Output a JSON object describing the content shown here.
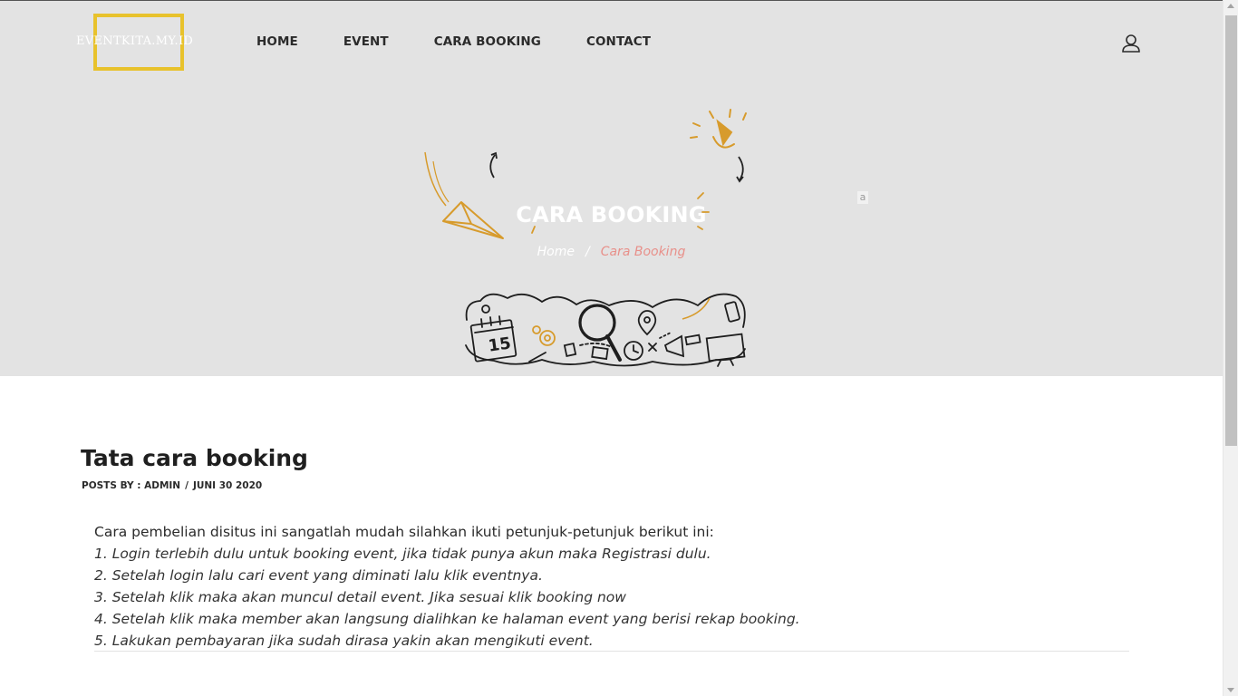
{
  "header": {
    "logo_text": "EVENTKITA.MY.ID",
    "nav": [
      {
        "label": "HOME"
      },
      {
        "label": "EVENT"
      },
      {
        "label": "CARA BOOKING"
      },
      {
        "label": "CONTACT"
      }
    ],
    "user_icon": "user-icon"
  },
  "hero": {
    "title": "CARA BOOKING",
    "breadcrumb": {
      "home": "Home",
      "separator": "/",
      "current": "Cara Booking"
    },
    "stray_text": "a",
    "calendar_number": "15"
  },
  "post": {
    "title": "Tata cara booking",
    "meta_author": "POSTS BY : ADMIN",
    "meta_sep": "/",
    "meta_date": "JUNI 30 2020",
    "intro": "Cara pembelian disitus ini sangatlah mudah silahkan ikuti petunjuk-petunjuk berikut ini:",
    "steps": [
      "1. Login terlebih dulu untuk booking event, jika tidak punya akun maka Registrasi dulu.",
      "2. Setelah login lalu cari event yang diminati lalu klik eventnya.",
      "3. Setelah klik maka akan muncul detail event. Jika sesuai klik booking now",
      "4. Setelah klik maka member akan langsung dialihkan ke halaman event yang berisi rekap booking.",
      "5. Lakukan pembayaran jika sudah dirasa yakin akan mengikuti event."
    ]
  },
  "colors": {
    "hero_bg": "#e3e3e3",
    "logo_border": "#e8c22c",
    "breadcrumb_current": "#e8908a",
    "illustration_accent": "#d79b2c"
  }
}
